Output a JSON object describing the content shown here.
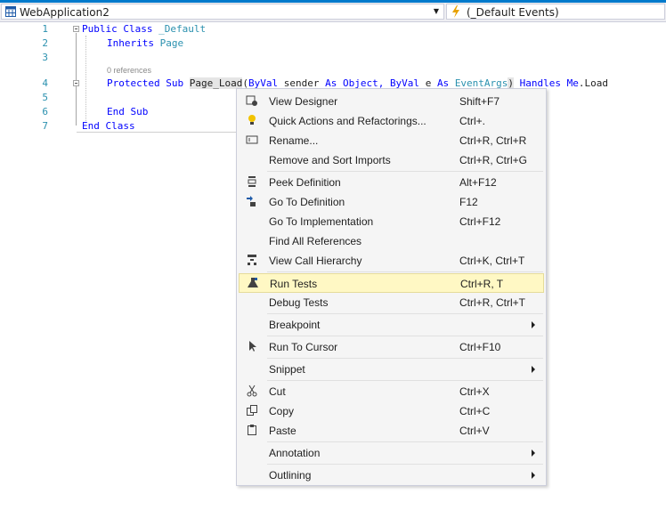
{
  "navbar": {
    "project": "WebApplication2",
    "events": "(_Default Events)"
  },
  "editor": {
    "line_numbers": [
      "1",
      "2",
      "3",
      "4",
      "5",
      "6",
      "7"
    ],
    "codelens": "0 references",
    "lines": {
      "l1_kw": "Public Class",
      "l1_name": "_Default",
      "l2_kw": "Inherits",
      "l2_type": "Page",
      "l4_a": "Protected Sub",
      "l4_method": "Page_Load",
      "l4_paren": "(",
      "l4_byval1": "ByVal",
      "l4_sender": "sender",
      "l4_as1": "As",
      "l4_object": "Object,",
      "l4_byval2": "ByVal",
      "l4_e": "e",
      "l4_as2": "As",
      "l4_eventargs": "EventArgs",
      "l4_close": ")",
      "l4_handles": "Handles",
      "l4_me": "Me",
      "l4_load": ".Load",
      "l6": "End Sub",
      "l7": "End Class"
    }
  },
  "context_menu": {
    "items": [
      {
        "label": "View Designer",
        "shortcut": "Shift+F7",
        "icon": "view-designer-icon"
      },
      {
        "label": "Quick Actions and Refactorings...",
        "shortcut": "Ctrl+.",
        "icon": "lightbulb-icon"
      },
      {
        "label": "Rename...",
        "shortcut": "Ctrl+R, Ctrl+R",
        "icon": "rename-icon"
      },
      {
        "label": "Remove and Sort Imports",
        "shortcut": "Ctrl+R, Ctrl+G"
      },
      {
        "label": "Peek Definition",
        "shortcut": "Alt+F12",
        "icon": "peek-icon"
      },
      {
        "label": "Go To Definition",
        "shortcut": "F12",
        "icon": "goto-definition-icon"
      },
      {
        "label": "Go To Implementation",
        "shortcut": "Ctrl+F12"
      },
      {
        "label": "Find All References",
        "shortcut": ""
      },
      {
        "label": "View Call Hierarchy",
        "shortcut": "Ctrl+K, Ctrl+T",
        "icon": "call-hierarchy-icon"
      },
      {
        "label": "Run Tests",
        "shortcut": "Ctrl+R, T",
        "icon": "flask-icon"
      },
      {
        "label": "Debug Tests",
        "shortcut": "Ctrl+R, Ctrl+T"
      },
      {
        "label": "Breakpoint",
        "shortcut": ""
      },
      {
        "label": "Run To Cursor",
        "shortcut": "Ctrl+F10",
        "icon": "cursor-icon"
      },
      {
        "label": "Snippet",
        "shortcut": ""
      },
      {
        "label": "Cut",
        "shortcut": "Ctrl+X",
        "icon": "scissors-icon"
      },
      {
        "label": "Copy",
        "shortcut": "Ctrl+C",
        "icon": "copy-icon"
      },
      {
        "label": "Paste",
        "shortcut": "Ctrl+V",
        "icon": "paste-icon"
      },
      {
        "label": "Annotation",
        "shortcut": ""
      },
      {
        "label": "Outlining",
        "shortcut": ""
      }
    ],
    "highlighted": "Run Tests"
  },
  "colors": {
    "accent": "#007acc",
    "keyword": "#0000ff",
    "type": "#2b91af",
    "highlight": "#fff8c4"
  }
}
